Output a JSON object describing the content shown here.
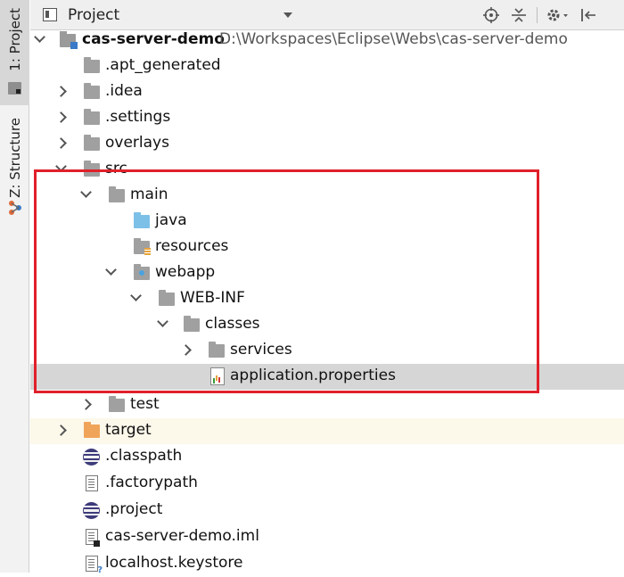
{
  "left_strip": {
    "project_tab": "1: Project",
    "structure_tab": "Z: Structure"
  },
  "header": {
    "title": "Project",
    "toolbar": [
      "locate-icon",
      "collapse-icon",
      "settings-icon",
      "hide-icon"
    ]
  },
  "tree": {
    "root": {
      "name": "cas-server-demo",
      "path": "D:\\Workspaces\\Eclipse\\Webs\\cas-server-demo"
    },
    "items": {
      "apt_generated": ".apt_generated",
      "idea": ".idea",
      "settings": ".settings",
      "overlays": "overlays",
      "src": "src",
      "main": "main",
      "java": "java",
      "resources": "resources",
      "webapp": "webapp",
      "web_inf": "WEB-INF",
      "classes": "classes",
      "services": "services",
      "application_properties": "application.properties",
      "test": "test",
      "target": "target",
      "classpath": ".classpath",
      "factorypath": ".factorypath",
      "project": ".project",
      "iml": "cas-server-demo.iml",
      "keystore": "localhost.keystore"
    }
  },
  "colors": {
    "highlight_box": "#e0202a",
    "selected_row": "#d6d6d6",
    "source_folder": "#7cc0e8",
    "target_folder": "#f0a45a"
  }
}
